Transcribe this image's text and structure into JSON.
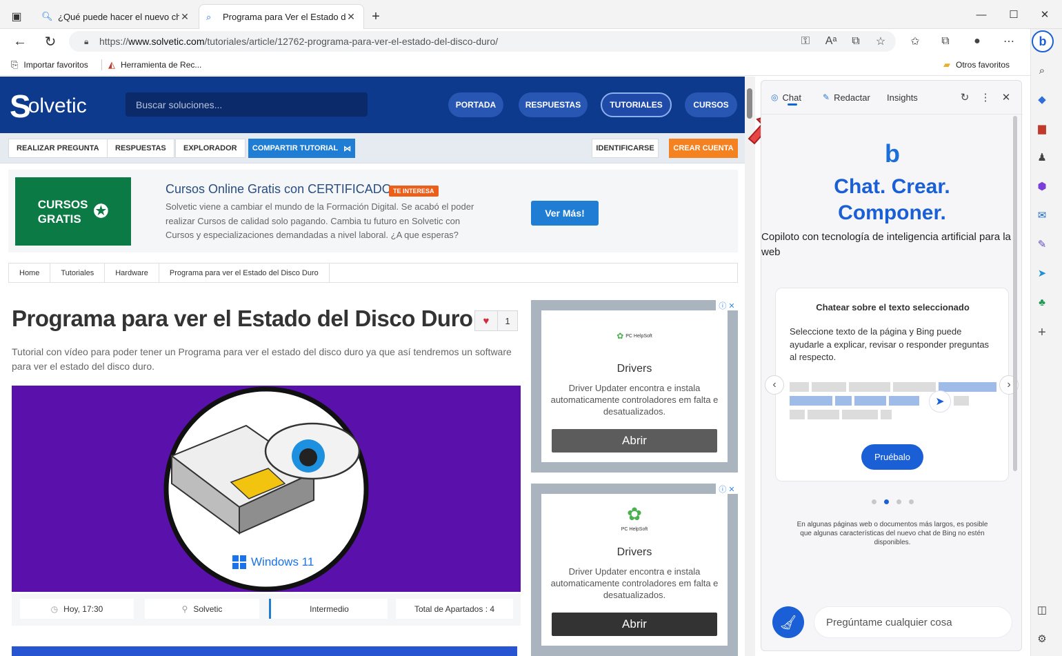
{
  "tabs": [
    {
      "title": "¿Qué puede hacer el nuevo chat",
      "icon": "search-icon"
    },
    {
      "title": "Programa para Ver el Estado del",
      "icon": "search-icon"
    }
  ],
  "address": {
    "prefix": "https://",
    "host": "www.solvetic.com",
    "path": "/tutoriales/article/12762-programa-para-ver-el-estado-del-disco-duro/"
  },
  "favorites": [
    {
      "label": "Importar favoritos",
      "icon": "import-icon"
    },
    {
      "label": "Herramienta de Rec...",
      "icon": "tool-icon"
    }
  ],
  "other_favorites": "Otros favoritos",
  "site": {
    "logo": "olvetic",
    "search_placeholder": "Buscar soluciones...",
    "nav": [
      "PORTADA",
      "RESPUESTAS",
      "TUTORIALES",
      "CURSOS"
    ],
    "subnav": {
      "preguntar": "REALIZAR PREGUNTA",
      "respuestas": "RESPUESTAS",
      "explorador": "EXPLORADOR",
      "compartir": "COMPARTIR TUTORIAL",
      "identificarse": "IDENTIFICARSE",
      "crear": "CREAR CUENTA"
    },
    "course": {
      "badge_line1": "CURSOS",
      "badge_line2": "GRATIS",
      "title": "Cursos Online Gratis con CERTIFICADO",
      "tag": "TE INTERESA",
      "desc": "Solvetic viene a cambiar el mundo de la Formación Digital. Se acabó el poder realizar Cursos de calidad solo pagando. Cambia tu futuro en Solvetic con Cursos y especializaciones demandadas a nivel laboral. ¿A que esperas?",
      "button": "Ver Más!"
    },
    "breadcrumbs": [
      "Home",
      "Tutoriales",
      "Hardware",
      "Programa para ver el Estado del Disco Duro"
    ],
    "article": {
      "title": "Programa para ver el Estado del Disco Duro",
      "likes": "1",
      "desc": "Tutorial con vídeo para poder tener un Programa para ver el estado del disco duro ya que así tendremos un software para ver el estado del disco duro.",
      "hero_caption": "Windows 11"
    },
    "meta": {
      "time": "Hoy, 17:30",
      "author": "Solvetic",
      "level": "Intermedio",
      "sections": "Total de Apartados : 4"
    },
    "ads": [
      {
        "brand": "PC HelpSoft",
        "title": "Drivers",
        "desc": "Driver Updater encontra e instala automaticamente controladores em falta e desatualizados.",
        "button": "Abrir"
      },
      {
        "brand": "PC HelpSoft",
        "title": "Drivers",
        "desc": "Driver Updater encontra e instala automaticamente controladores em falta e desatualizados.",
        "button": "Abrir"
      }
    ]
  },
  "copilot": {
    "tabs": [
      "Chat",
      "Redactar",
      "Insights"
    ],
    "hero_line1": "Chat. Crear.",
    "hero_line2": "Componer.",
    "subtitle": "Copiloto con tecnología de inteligencia artificial para la web",
    "card_title": "Chatear sobre el texto seleccionado",
    "card_desc": "Seleccione texto de la página y Bing puede ayudarle a explicar, revisar o responder preguntas al respecto.",
    "try_button": "Pruébalo",
    "carousel": {
      "pages": 4,
      "active": 2
    },
    "note": "En algunas páginas web o documentos más largos, es posible que algunas características del nuevo chat de Bing no estén disponibles.",
    "ask_placeholder": "Pregúntame cualquier cosa"
  },
  "colors": {
    "site_header": "#0d3a8c",
    "accent_blue": "#1a5fd6",
    "orange": "#f58220",
    "course_green": "#0b7a45",
    "hero_purple": "#5a10ab"
  }
}
